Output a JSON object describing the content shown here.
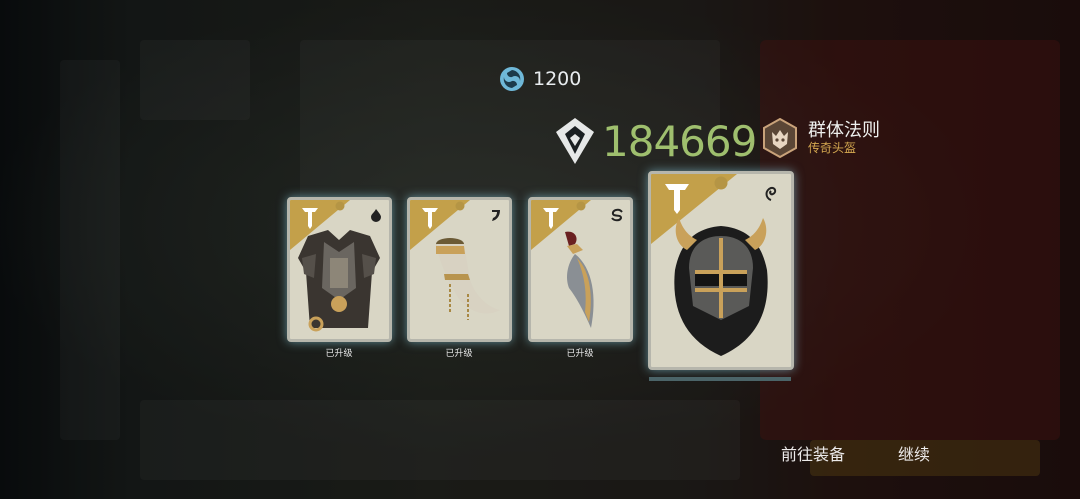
{
  "currency": {
    "icon": "swirl-currency-icon",
    "value": "1200"
  },
  "power": {
    "icon": "power-gem-icon",
    "value": "184669",
    "color": "#9fbf6e"
  },
  "set": {
    "icon": "wolf-skull-badge-icon",
    "name": "群体法则",
    "rarity": "传奇头盔",
    "rarity_color": "#d4a850"
  },
  "cards": [
    {
      "item": "armor-chest",
      "element_icon": "flame-icon",
      "label": "已升级"
    },
    {
      "item": "drinking-horn",
      "element_icon": "hook-icon",
      "label": "已升级"
    },
    {
      "item": "curved-blade",
      "element_icon": "swirl-s-icon",
      "label": "已升级"
    },
    {
      "item": "horned-helmet",
      "element_icon": "spiral-icon",
      "label": "",
      "selected": true
    }
  ],
  "buttons": {
    "go_equip": "前往装备",
    "continue": "继续"
  }
}
